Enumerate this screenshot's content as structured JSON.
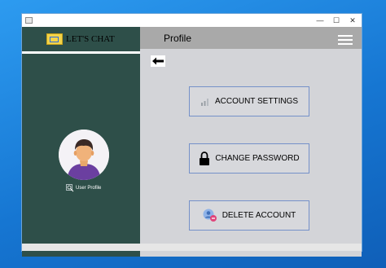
{
  "window": {
    "minimize_glyph": "—",
    "maximize_glyph": "☐",
    "close_glyph": "✕"
  },
  "sidebar": {
    "brand_title": "LET'S CHAT",
    "profile_link_label": "User Profile"
  },
  "header": {
    "title": "Profile"
  },
  "actions": {
    "account_settings_label": "ACCOUNT SETTINGS",
    "change_password_label": "CHANGE PASSWORD",
    "delete_account_label": "DELETE ACCOUNT"
  },
  "icons": {
    "back": "arrow-left-icon",
    "menu": "hamburger-menu-icon",
    "account_settings": "bar-chart-icon",
    "change_password": "lock-icon",
    "delete_account": "user-remove-icon"
  },
  "colors": {
    "sidebar": "#2e4f49",
    "header": "#a9a9a9",
    "content": "#d3d4d8",
    "button_border": "#7591c9"
  }
}
